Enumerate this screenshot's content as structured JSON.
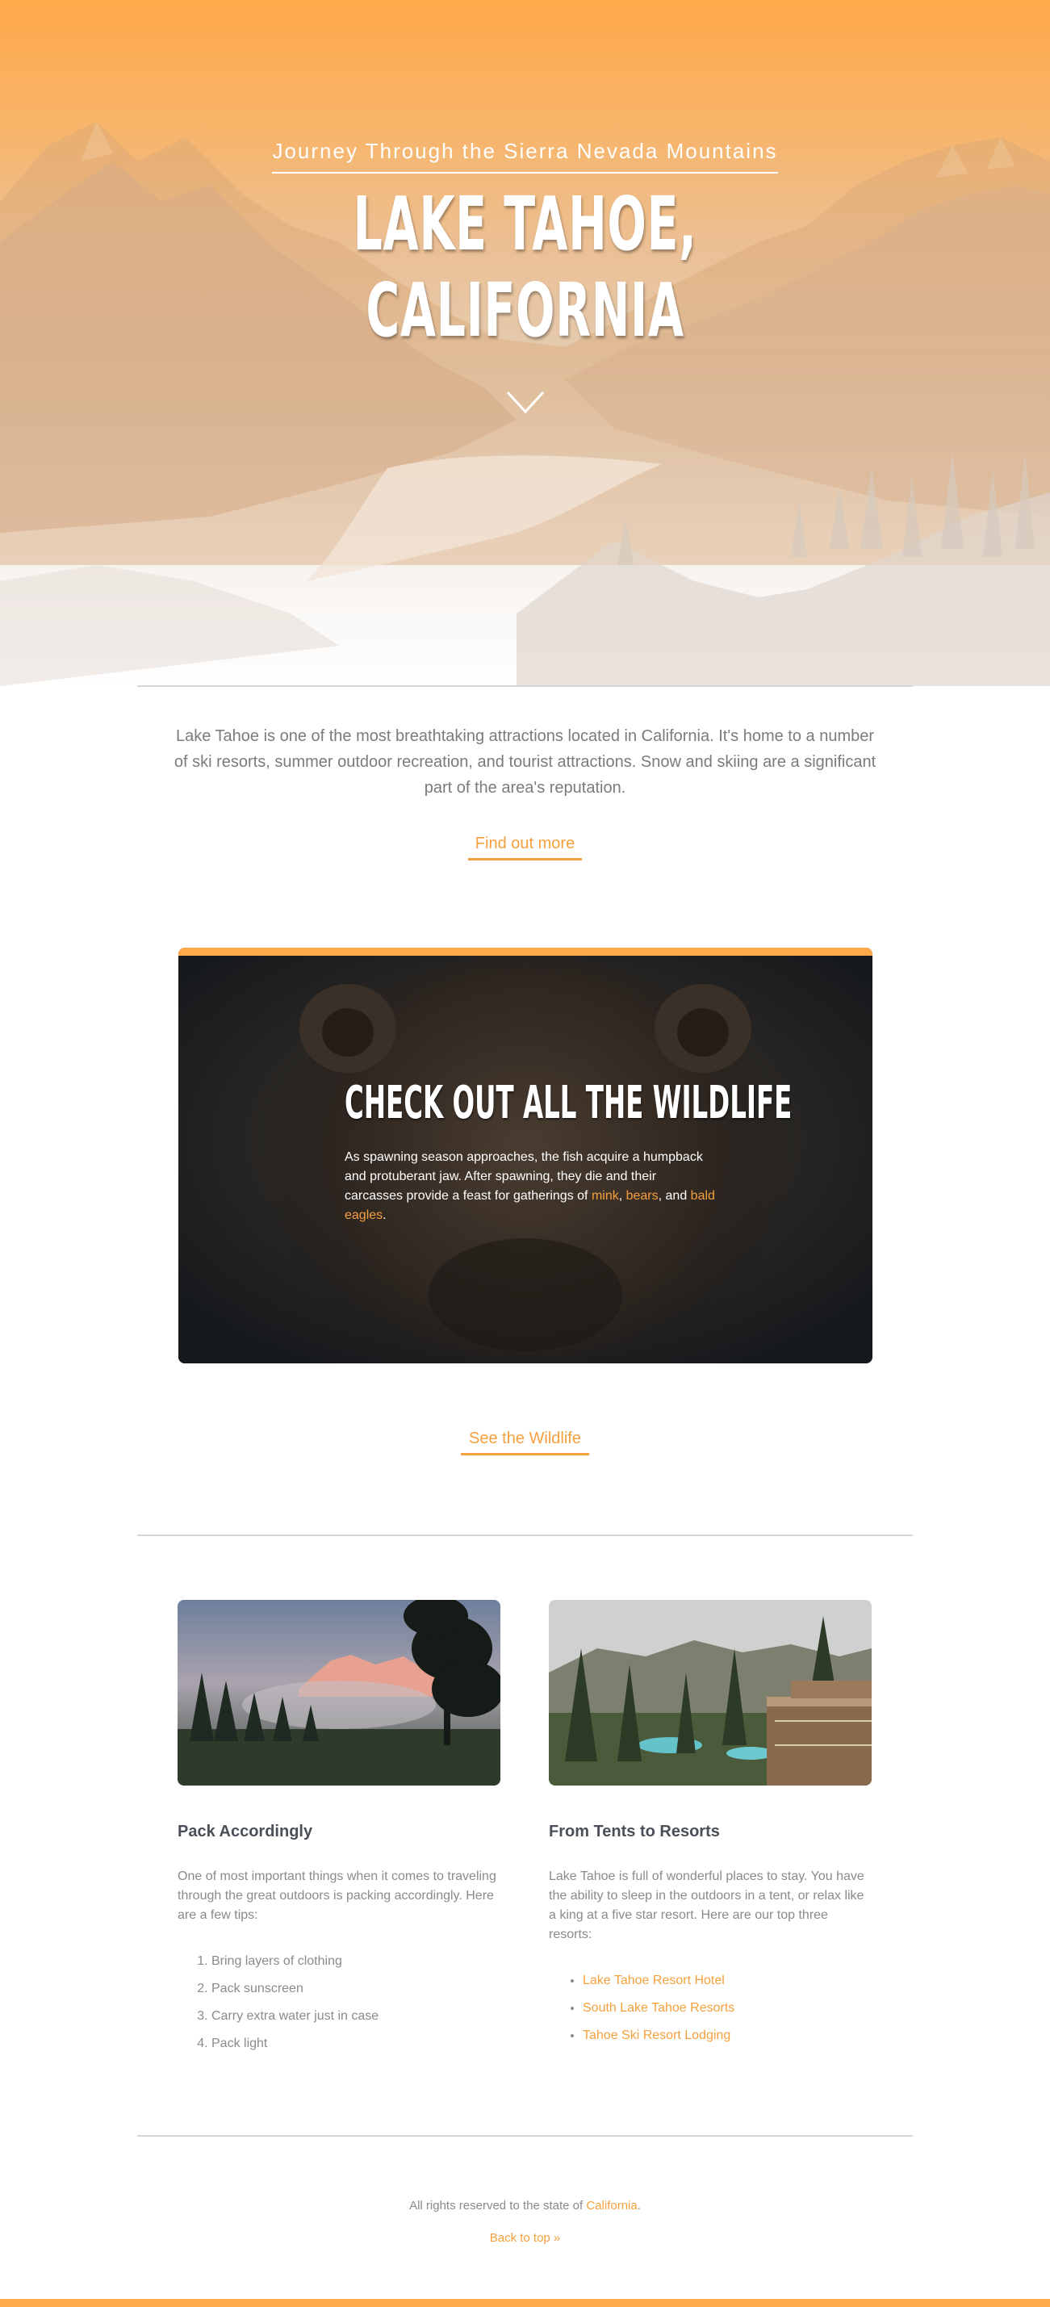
{
  "colors": {
    "accent": "#f5a03d",
    "hero_top": "#ffa94a"
  },
  "hero": {
    "subtitle": "Journey Through the Sierra Nevada Mountains",
    "title": "LAKE TAHOE, CALIFORNIA",
    "scroll_icon": "chevron-down-icon"
  },
  "intro": {
    "text": "Lake Tahoe is one of the most breathtaking attractions located in California. It's home to a number of ski resorts, summer outdoor recreation, and tourist attractions. Snow and skiing are a significant part of the area's reputation.",
    "button": "Find out more"
  },
  "wildlife": {
    "title": "CHECK OUT ALL THE WILDLIFE",
    "text_start": "As spawning season approaches, the fish acquire a humpback and protuberant jaw. After spawning, they die and their carcasses provide a feast for gatherings of ",
    "link_mink": "mink",
    "sep1": ", ",
    "link_bears": "bears",
    "sep2": ", and ",
    "link_eagles": "bald eagles",
    "end": ".",
    "button": "See the Wildlife"
  },
  "pack": {
    "title": "Pack Accordingly",
    "text": "One of most important things when it comes to traveling through the great outdoors is packing accordingly. Here are a few tips:",
    "tips": [
      "Bring layers of clothing",
      "Pack sunscreen",
      "Carry extra water just in case",
      "Pack light"
    ]
  },
  "resorts": {
    "title": "From Tents to Resorts",
    "text": "Lake Tahoe is full of wonderful places to stay. You have the ability to sleep in the outdoors in a tent, or relax like a king at a five star resort. Here are our top three resorts:",
    "items": [
      "Lake Tahoe Resort Hotel",
      "South Lake Tahoe Resorts",
      "Tahoe Ski Resort Lodging"
    ]
  },
  "footer": {
    "text_start": "All rights reserved to the state of ",
    "link": "California",
    "end": ".",
    "back_to_top": "Back to top »"
  }
}
